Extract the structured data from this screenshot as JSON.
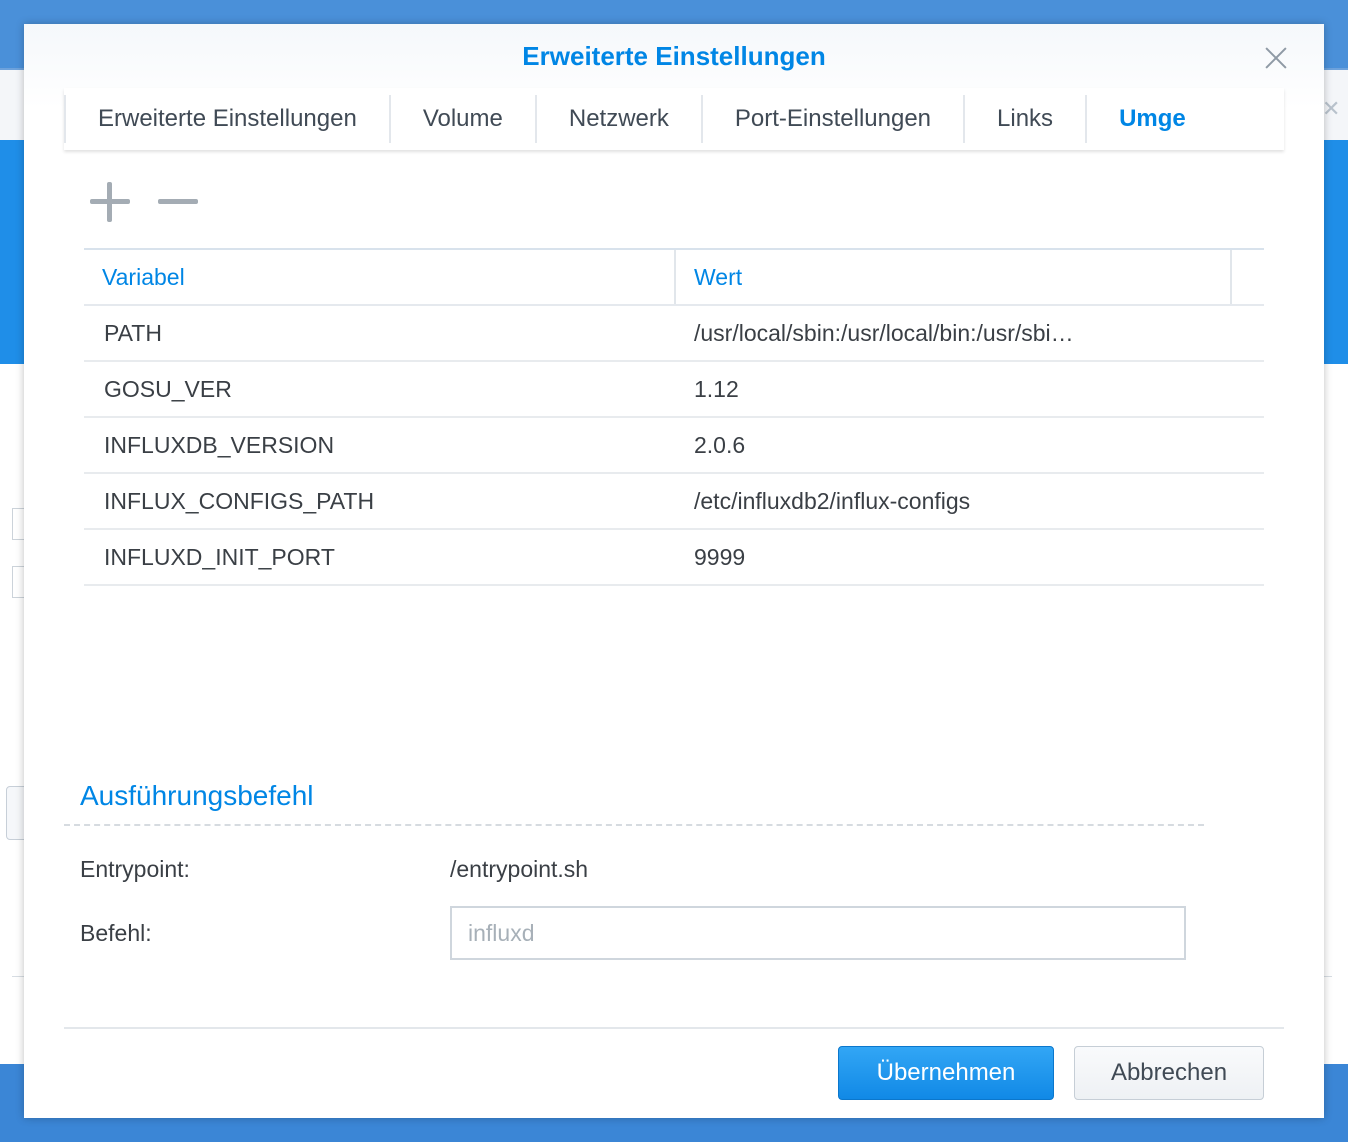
{
  "dialog": {
    "title": "Erweiterte Einstellungen"
  },
  "tabs": [
    {
      "label": "Erweiterte Einstellungen",
      "active": false
    },
    {
      "label": "Volume",
      "active": false
    },
    {
      "label": "Netzwerk",
      "active": false
    },
    {
      "label": "Port-Einstellungen",
      "active": false
    },
    {
      "label": "Links",
      "active": false
    },
    {
      "label": "Umge",
      "active": true
    }
  ],
  "toolbar": {
    "add_icon": "plus-icon",
    "remove_icon": "minus-icon"
  },
  "grid": {
    "columns": [
      "Variabel",
      "Wert"
    ],
    "rows": [
      {
        "variable": "PATH",
        "value": "/usr/local/sbin:/usr/local/bin:/usr/sbi…"
      },
      {
        "variable": "GOSU_VER",
        "value": "1.12"
      },
      {
        "variable": "INFLUXDB_VERSION",
        "value": "2.0.6"
      },
      {
        "variable": "INFLUX_CONFIGS_PATH",
        "value": "/etc/influxdb2/influx-configs"
      },
      {
        "variable": "INFLUXD_INIT_PORT",
        "value": "9999"
      }
    ]
  },
  "execution": {
    "section_title": "Ausführungsbefehl",
    "entrypoint_label": "Entrypoint:",
    "entrypoint_value": "/entrypoint.sh",
    "command_label": "Befehl:",
    "command_placeholder": "influxd",
    "command_value": ""
  },
  "buttons": {
    "apply": "Übernehmen",
    "cancel": "Abbrechen"
  },
  "colors": {
    "accent": "#0086e5",
    "primary_button": "#1e96ee"
  }
}
